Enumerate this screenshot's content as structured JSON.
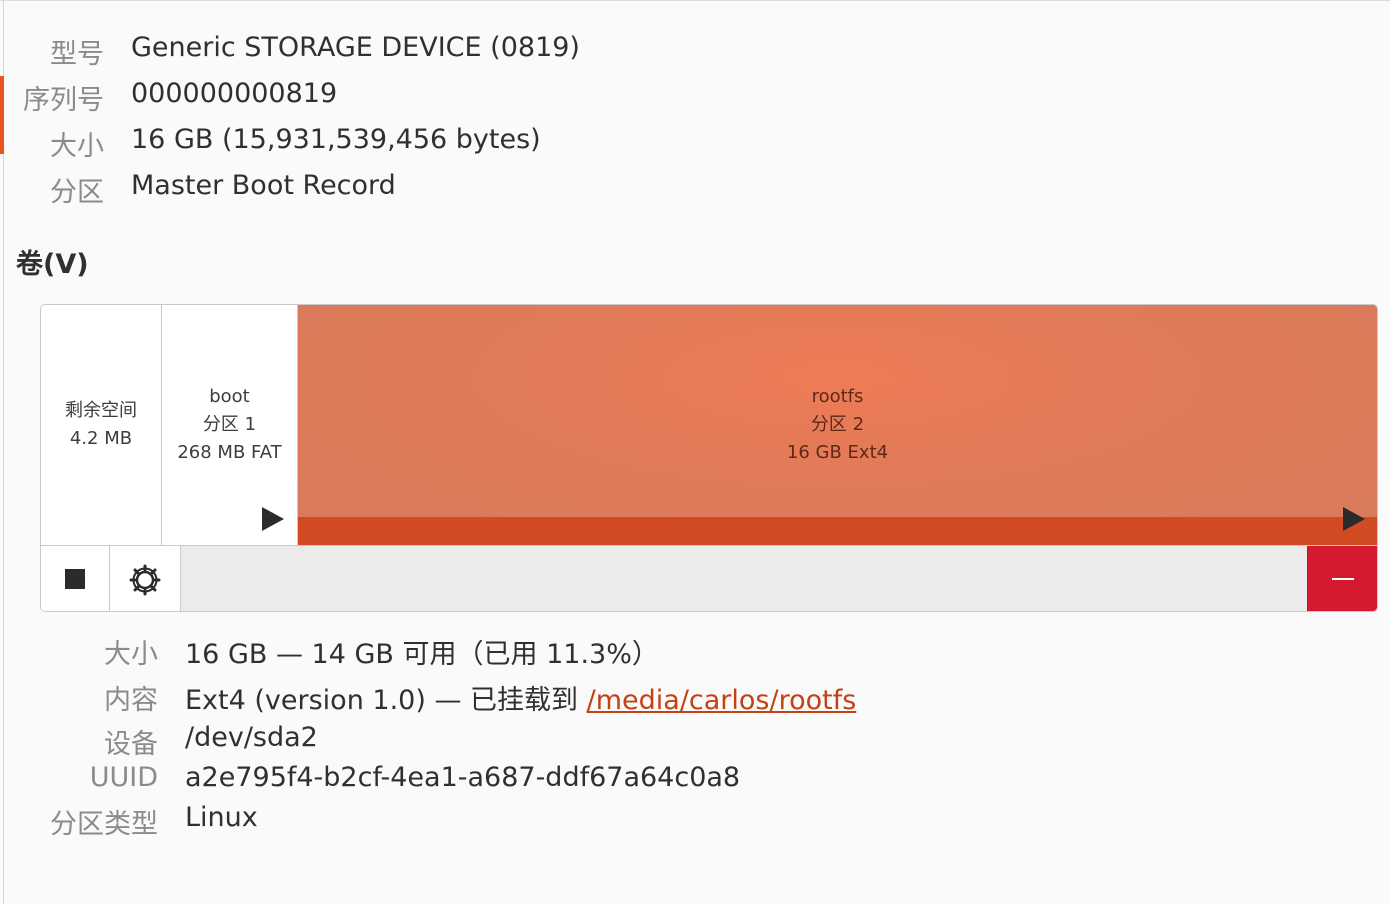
{
  "drive": {
    "model_label": "型号",
    "model_value": "Generic STORAGE DEVICE (0819)",
    "serial_label": "序列号",
    "serial_value": "000000000819",
    "size_label": "大小",
    "size_value": "16 GB (15,931,539,456 bytes)",
    "partitioning_label": "分区",
    "partitioning_value": "Master Boot Record"
  },
  "volumes_title": "卷(V)",
  "segments": [
    {
      "name": "剩余空间",
      "size": "4.2 MB"
    },
    {
      "name": "boot",
      "partition": "分区 1",
      "desc": "268 MB FAT"
    },
    {
      "name": "rootfs",
      "partition": "分区 2",
      "desc": "16 GB Ext4",
      "used_fraction": 0.113
    }
  ],
  "toolbar": {
    "stop_icon": "stop-icon",
    "settings_icon": "gear-icon",
    "delete_icon": "minus-icon",
    "delete_color": "#d51a2f"
  },
  "colors": {
    "accent": "#e95420",
    "partition_fill": "#e07a58",
    "usage_fill": "#d24a22",
    "link": "#c34113"
  },
  "details": {
    "size_label": "大小",
    "size_value": "16 GB — 14 GB 可用（已用 11.3%）",
    "contents_label": "内容",
    "contents_prefix": "Ext4 (version 1.0) — 已挂载到 ",
    "contents_link": "/media/carlos/rootfs",
    "device_label": "设备",
    "device_value": "/dev/sda2",
    "uuid_label": "UUID",
    "uuid_value": "a2e795f4-b2cf-4ea1-a687-ddf67a64c0a8",
    "parttype_label": "分区类型",
    "parttype_value": "Linux"
  }
}
